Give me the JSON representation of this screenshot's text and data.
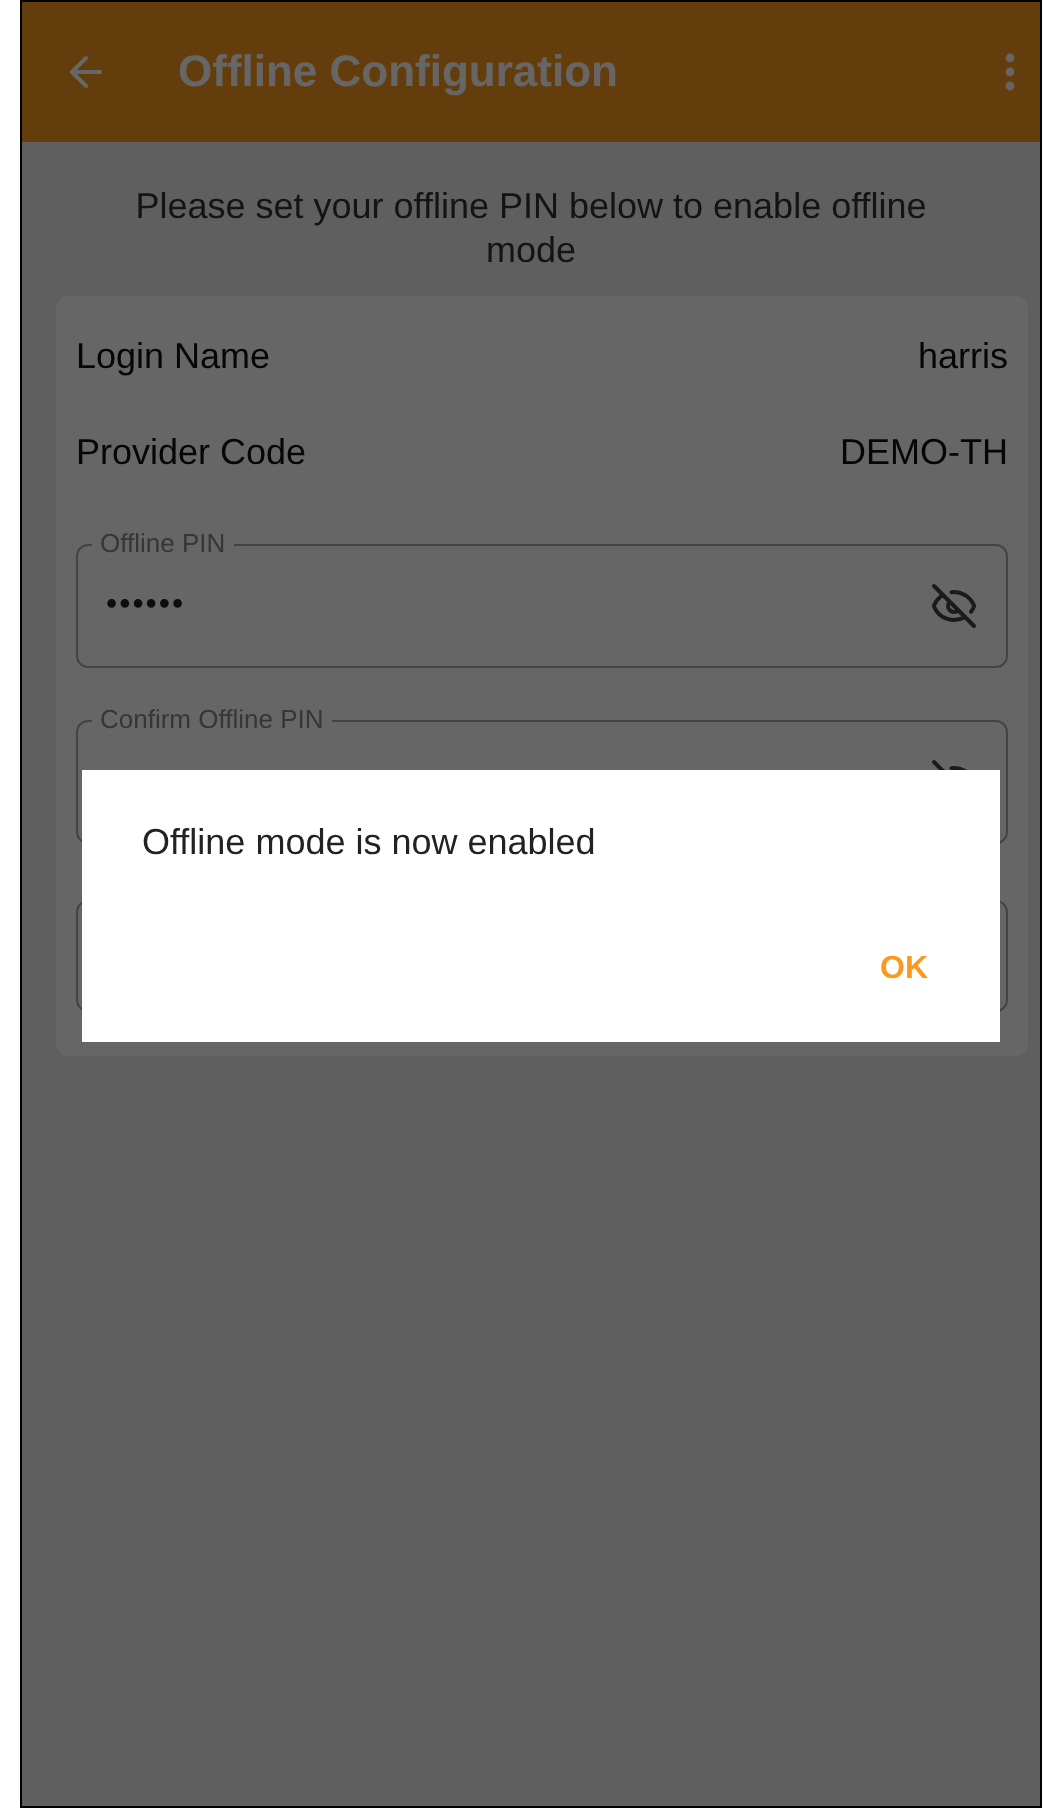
{
  "app_bar": {
    "title": "Offline Configuration"
  },
  "instruction": "Please set your offline PIN below to enable offline mode",
  "info_rows": [
    {
      "label": "Login Name",
      "value": "harris"
    },
    {
      "label": "Provider Code",
      "value": "DEMO-TH"
    }
  ],
  "fields": [
    {
      "label": "Offline PIN",
      "value": "••••••",
      "masked": true
    },
    {
      "label": "Confirm Offline PIN",
      "masked": true
    }
  ],
  "dialog": {
    "message": "Offline mode is now enabled",
    "buttons": [
      "OK"
    ]
  }
}
